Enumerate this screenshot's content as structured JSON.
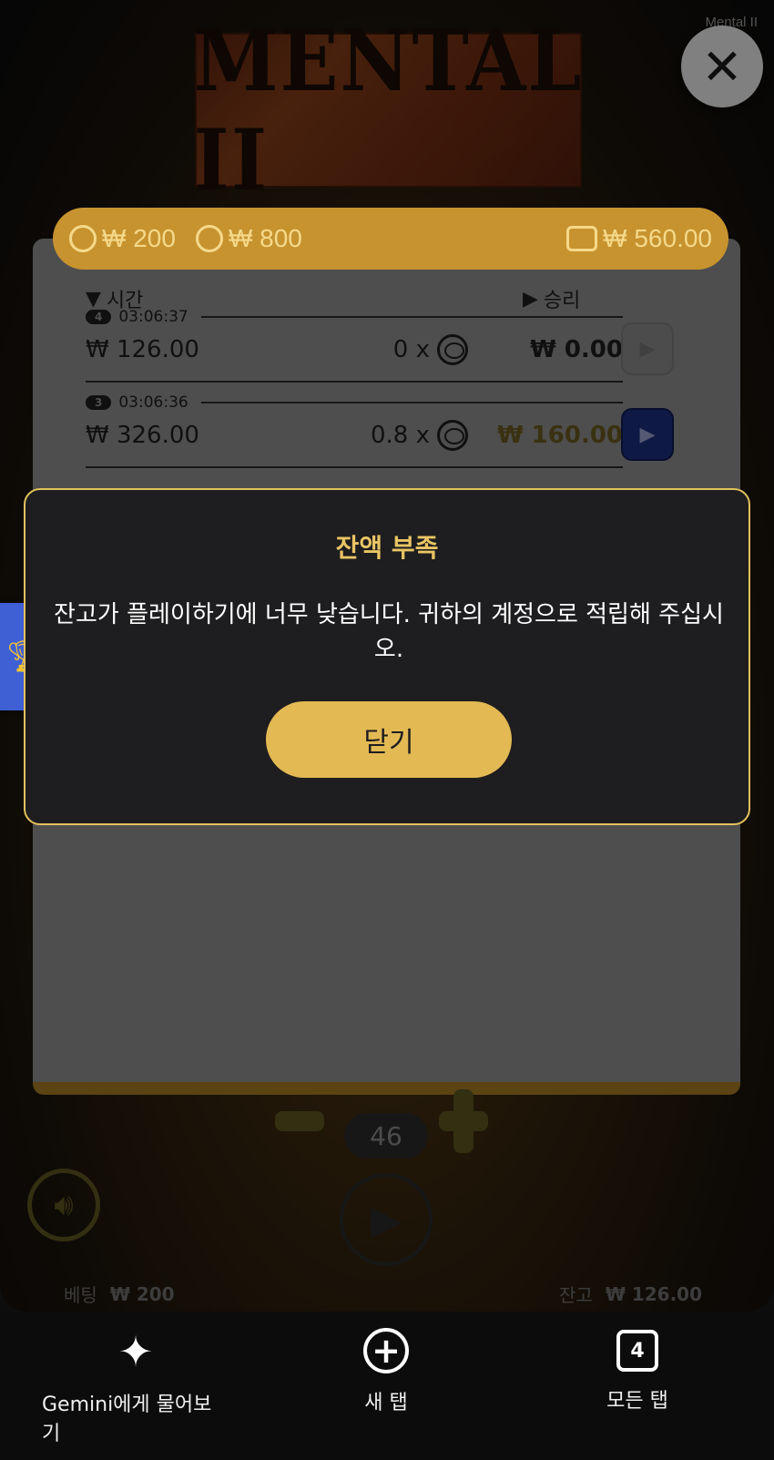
{
  "game": {
    "brand_label": "Mental II",
    "logo_text": "MENTAL II",
    "close_glyph": "✕",
    "info_bar": {
      "min_bet": "₩ 200",
      "max_bet": "₩ 800",
      "balance": "₩ 560.00"
    },
    "columns": {
      "time_label": "시간",
      "win_label": "승리"
    },
    "bets": [
      {
        "round": "4",
        "time": "03:06:37",
        "amount": "₩ 126.00",
        "multiplier": "0 x",
        "win": "₩ 0.00",
        "win_color": "#1e1e1e"
      },
      {
        "round": "3",
        "time": "03:06:36",
        "amount": "₩ 326.00",
        "multiplier": "0.8 x",
        "win": "₩ 160.00",
        "win_color": "#6b5a22"
      }
    ],
    "stepper_value": "46",
    "bottom": {
      "bet_label": "베팅",
      "bet_value": "₩ 200",
      "balance_label": "잔고",
      "balance_value": "₩ 126.00"
    }
  },
  "modal": {
    "title": "잔액 부족",
    "message": "잔고가 플레이하기에 너무 낮습니다. 귀하의 계정으로 적립해 주십시오.",
    "close_label": "닫기"
  },
  "browser_bar": {
    "gemini_label": "Gemini에게 물어보기",
    "new_tab_label": "새 탭",
    "all_tabs_label": "모든 탭",
    "tab_count": "4"
  },
  "colors": {
    "accent_gold": "#e2b953",
    "info_bar": "#c7932f",
    "play_blue": "#1c2f7f"
  }
}
